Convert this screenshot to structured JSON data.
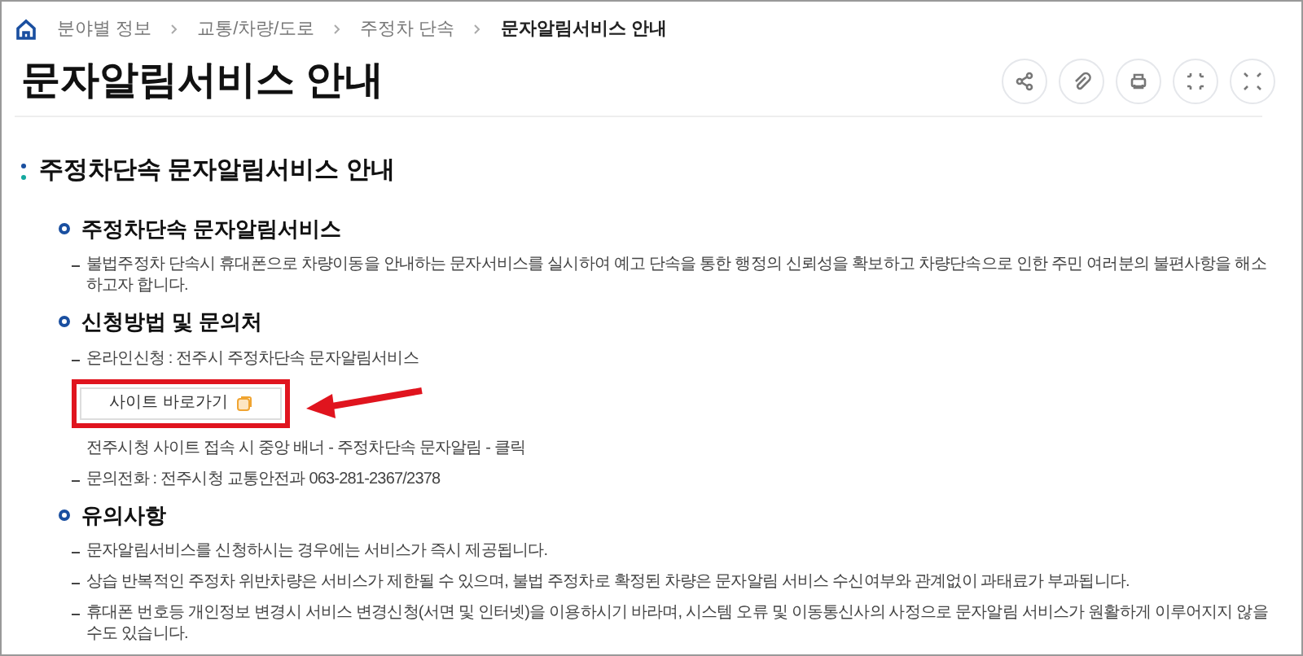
{
  "breadcrumb": [
    {
      "label": "분야별 정보",
      "current": false
    },
    {
      "label": "교통/차량/도로",
      "current": false
    },
    {
      "label": "주정차 단속",
      "current": false
    },
    {
      "label": "문자알림서비스 안내",
      "current": true
    }
  ],
  "title": "문자알림서비스 안내",
  "section_title": "주정차단속 문자알림서비스 안내",
  "subsections": [
    {
      "title": "주정차단속 문자알림서비스",
      "items": [
        {
          "kind": "bullet",
          "text": "불법주정차 단속시 휴대폰으로 차량이동을 안내하는 문자서비스를 실시하여 예고 단속을 통한 행정의 신뢰성을 확보하고 차량단속으로 인한 주민 여러분의 불편사항을 해소하고자 합니다."
        }
      ]
    },
    {
      "title": "신청방법 및 문의처",
      "items": [
        {
          "kind": "bullet",
          "text": "온라인신청 : 전주시 주정차단속 문자알림서비스"
        },
        {
          "kind": "button",
          "text": "사이트 바로가기",
          "highlighted": true
        },
        {
          "kind": "note",
          "text": "전주시청 사이트 접속 시 중앙 배너 - 주정차단속 문자알림 - 클릭"
        },
        {
          "kind": "bullet",
          "text": "문의전화 : 전주시청 교통안전과 063-281-2367/2378"
        }
      ]
    },
    {
      "title": "유의사항",
      "items": [
        {
          "kind": "bullet",
          "text": "문자알림서비스를 신청하시는 경우에는 서비스가 즉시 제공됩니다."
        },
        {
          "kind": "bullet",
          "text": "상습 반복적인 주정차 위반차량은 서비스가 제한될 수 있으며, 불법 주정차로 확정된 차량은 문자알림 서비스 수신여부와 관계없이 과태료가 부과됩니다."
        },
        {
          "kind": "bullet",
          "text": "휴대폰 번호등 개인정보 변경시 서비스 변경신청(서면 및 인터넷)을 이용하시기 바라며, 시스템 오류 및 이동통신사의 사정으로 문자알림 서비스가 원활하게 이루어지지 않을 수도 있습니다."
        }
      ]
    }
  ]
}
